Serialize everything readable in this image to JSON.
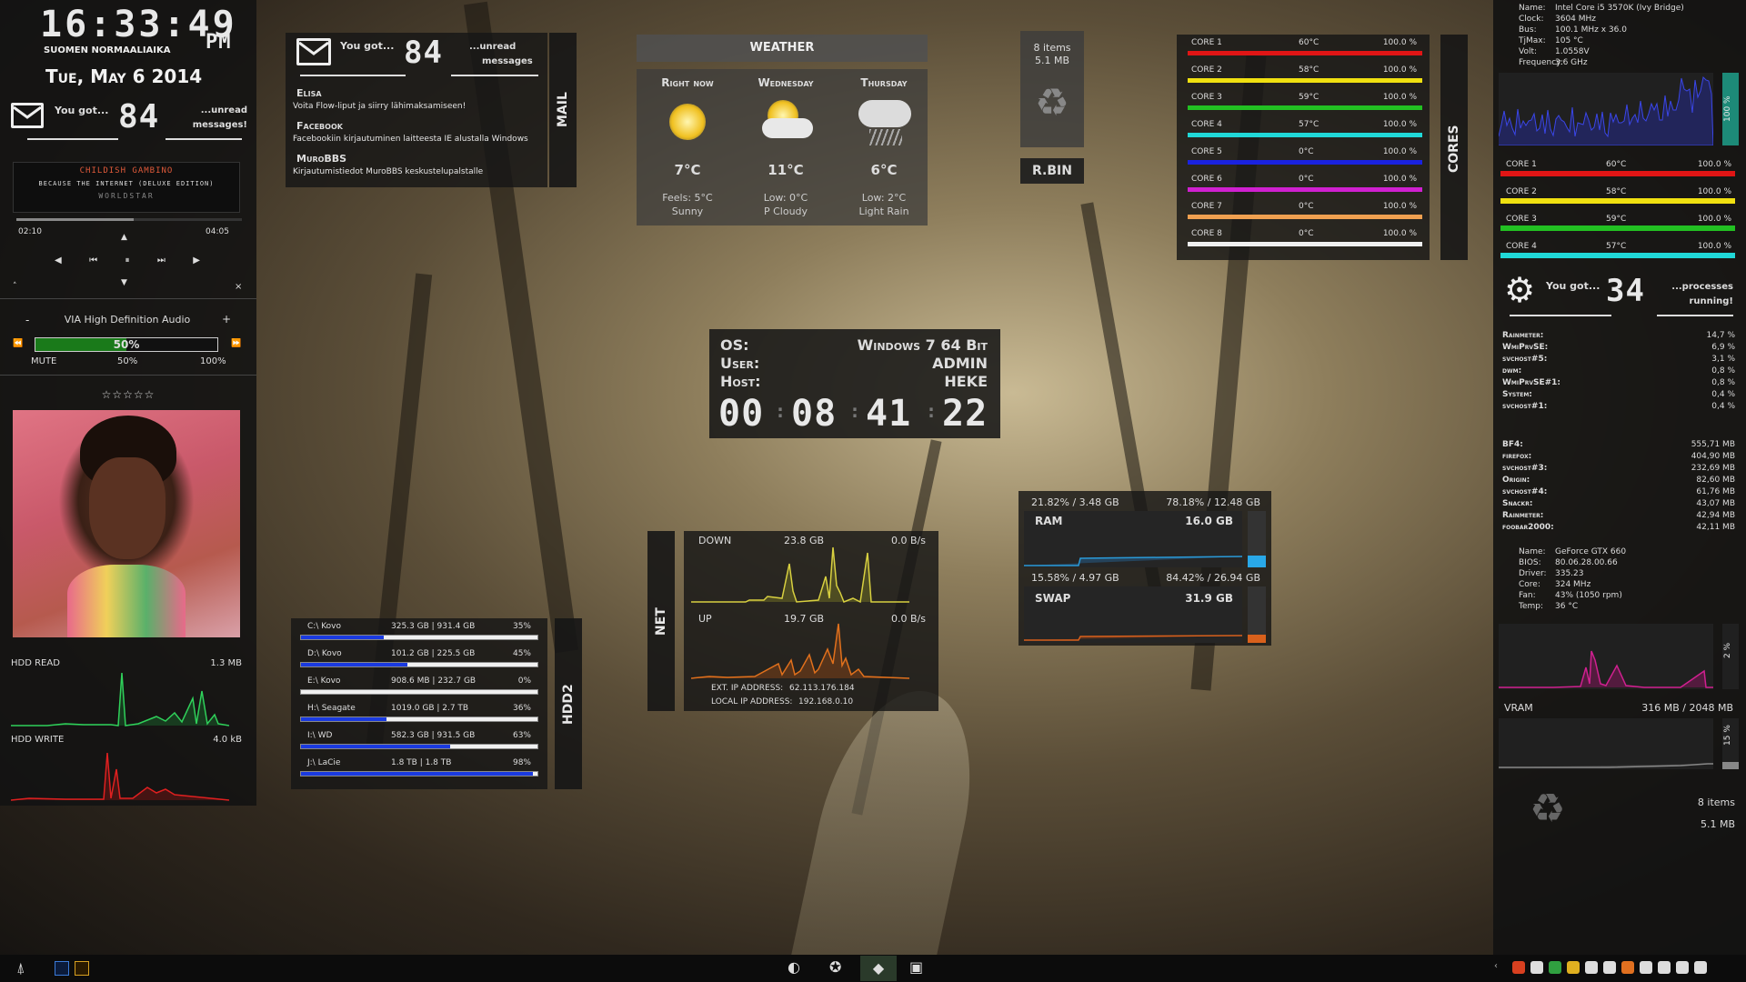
{
  "clock": {
    "time": "16:33:49",
    "ampm": "PM",
    "zone": "SUOMEN NORMAALIAIKA",
    "date": "Tue, May 6 2014"
  },
  "mail_left": {
    "label": "You got...",
    "count": "84",
    "suffix": "...unread messages!"
  },
  "music": {
    "artist": "CHILDISH GAMBINO",
    "album": "BECAUSE THE INTERNET (DELUXE EDITION)",
    "source": "WORLDSTAR",
    "elapsed": "02:10",
    "total": "04:05",
    "progress": 0.52,
    "rating": "☆☆☆☆☆"
  },
  "volume": {
    "device": "VIA High Definition Audio",
    "minus": "-",
    "plus": "+",
    "level": "50%",
    "mute": "MUTE",
    "mid": "50%",
    "max": "100%",
    "fill": 0.5
  },
  "hdd_io": {
    "read_label": "HDD READ",
    "read_value": "1.3 MB",
    "write_label": "HDD WRITE",
    "write_value": "4.0 kB"
  },
  "mail": {
    "label": "You got...",
    "count": "84",
    "suffix1": "...unread",
    "suffix2": "messages",
    "side": "MAIL",
    "items": [
      {
        "from": "Elisa",
        "text": "Voita Flow-liput ja siirry lähimaksamiseen!"
      },
      {
        "from": "Facebook",
        "text": "Facebookiin kirjautuminen laitteesta IE alustalla Windows"
      },
      {
        "from": "MuroBBS",
        "text": "Kirjautumistiedot MuroBBS keskustelupalstalle"
      }
    ]
  },
  "weather": {
    "title": "WEATHER",
    "days": [
      {
        "name": "Right now",
        "temp": "7°C",
        "l1": "Feels: 5°C",
        "l2": "Sunny"
      },
      {
        "name": "Wednesday",
        "temp": "11°C",
        "l1": "Low: 0°C",
        "l2": "P Cloudy"
      },
      {
        "name": "Thursday",
        "temp": "6°C",
        "l1": "Low: 2°C",
        "l2": "Light Rain"
      }
    ]
  },
  "rbin": {
    "items": "8 items",
    "size": "5.1 MB",
    "label": "R.BIN"
  },
  "cores": {
    "side": "CORES",
    "rows": [
      {
        "name": "CORE 1",
        "temp": "60°C",
        "load": "100.0 %",
        "color": "#e01515"
      },
      {
        "name": "CORE 2",
        "temp": "58°C",
        "load": "100.0 %",
        "color": "#f0e010"
      },
      {
        "name": "CORE 3",
        "temp": "59°C",
        "load": "100.0 %",
        "color": "#22c022"
      },
      {
        "name": "CORE 4",
        "temp": "57°C",
        "load": "100.0 %",
        "color": "#20d8d8"
      },
      {
        "name": "CORE 5",
        "temp": "0°C",
        "load": "100.0 %",
        "color": "#1a22e0"
      },
      {
        "name": "CORE 6",
        "temp": "0°C",
        "load": "100.0 %",
        "color": "#d020d0"
      },
      {
        "name": "CORE 7",
        "temp": "0°C",
        "load": "100.0 %",
        "color": "#f0a050"
      },
      {
        "name": "CORE 8",
        "temp": "0°C",
        "load": "100.0 %",
        "color": "#f0f0f0"
      }
    ]
  },
  "sysinfo": {
    "os_label": "OS:",
    "os": "Windows 7 64 Bit",
    "user_label": "User:",
    "user": "ADMIN",
    "host_label": "Host:",
    "host": "HEKE",
    "uptime": [
      "00",
      "08",
      "41",
      "22"
    ]
  },
  "ram": {
    "used": "21.82% / 3.48 GB",
    "free": "78.18% / 12.48 GB",
    "label": "RAM",
    "total": "16.0 GB",
    "swap_used": "15.58% / 4.97 GB",
    "swap_free": "84.42% / 26.94 GB",
    "swap_label": "SWAP",
    "swap_total": "31.9 GB"
  },
  "net": {
    "side": "NET",
    "down": "DOWN",
    "down_total": "23.8 GB",
    "down_rate": "0.0 B/s",
    "up": "UP",
    "up_total": "19.7 GB",
    "up_rate": "0.0 B/s",
    "ext_label": "EXT. IP ADDRESS:",
    "ext": "62.113.176.184",
    "local_label": "LOCAL IP ADDRESS:",
    "local": "192.168.0.10"
  },
  "drives": {
    "side": "HDD2",
    "rows": [
      {
        "name": "C:\\ Kovo",
        "size": "325.3 GB | 931.4 GB",
        "pct": "35%",
        "fill": 0.35
      },
      {
        "name": "D:\\ Kovo",
        "size": "101.2 GB | 225.5 GB",
        "pct": "45%",
        "fill": 0.45
      },
      {
        "name": "E:\\ Kovo",
        "size": "908.6 MB | 232.7 GB",
        "pct": "0%",
        "fill": 0.0
      },
      {
        "name": "H:\\ Seagate",
        "size": "1019.0 GB | 2.7 TB",
        "pct": "36%",
        "fill": 0.36
      },
      {
        "name": "I:\\ WD",
        "size": "582.3 GB | 931.5 GB",
        "pct": "63%",
        "fill": 0.63
      },
      {
        "name": "J:\\ LaCie",
        "size": "1.8 TB | 1.8 TB",
        "pct": "98%",
        "fill": 0.98
      }
    ]
  },
  "cpu": {
    "lines": [
      [
        "Name:",
        "Intel Core i5 3570K (Ivy Bridge)"
      ],
      [
        "Clock:",
        "3604 MHz"
      ],
      [
        "Bus:",
        "100.1 MHz x 36.0"
      ],
      [
        "TjMax:",
        "105 °C"
      ],
      [
        "Volt:",
        "1.0558V"
      ],
      [
        "Frequency:",
        "3.6 GHz"
      ]
    ],
    "pct": "100 %",
    "cores": [
      {
        "name": "CORE 1",
        "temp": "60°C",
        "load": "100.0 %",
        "color": "#e01515"
      },
      {
        "name": "CORE 2",
        "temp": "58°C",
        "load": "100.0 %",
        "color": "#f0e010"
      },
      {
        "name": "CORE 3",
        "temp": "59°C",
        "load": "100.0 %",
        "color": "#22c022"
      },
      {
        "name": "CORE 4",
        "temp": "57°C",
        "load": "100.0 %",
        "color": "#20d8d8"
      }
    ]
  },
  "procs": {
    "label": "You got...",
    "count": "34",
    "suffix1": "...processes",
    "suffix2": "running!",
    "cpu": [
      [
        "Rainmeter:",
        "14,7 %"
      ],
      [
        "WmiPrvSE:",
        "6,9 %"
      ],
      [
        "svchost#5:",
        "3,1 %"
      ],
      [
        "dwm:",
        "0,8 %"
      ],
      [
        "WmiPrvSE#1:",
        "0,8 %"
      ],
      [
        "System:",
        "0,4 %"
      ],
      [
        "svchost#1:",
        "0,4 %"
      ]
    ],
    "mem": [
      [
        "BF4:",
        "555,71 MB"
      ],
      [
        "firefox:",
        "404,90 MB"
      ],
      [
        "svchost#3:",
        "232,69 MB"
      ],
      [
        "Origin:",
        "82,60 MB"
      ],
      [
        "svchost#4:",
        "61,76 MB"
      ],
      [
        "Snackr:",
        "43,07 MB"
      ],
      [
        "Rainmeter:",
        "42,94 MB"
      ],
      [
        "foobar2000:",
        "42,11 MB"
      ]
    ]
  },
  "gpu": {
    "lines": [
      [
        "Name:",
        "GeForce GTX 660"
      ],
      [
        "BIOS:",
        "80.06.28.00.66"
      ],
      [
        "Driver:",
        "335.23"
      ],
      [
        "Core:",
        "324 MHz"
      ],
      [
        "Fan:",
        "43% (1050 rpm)"
      ],
      [
        "Temp:",
        "36 °C"
      ]
    ],
    "pct": "2 %",
    "vram_label": "VRAM",
    "vram": "316 MB / 2048 MB",
    "vram_pct": "15 %"
  },
  "rbin2": {
    "items": "8 items",
    "size": "5.1 MB"
  }
}
